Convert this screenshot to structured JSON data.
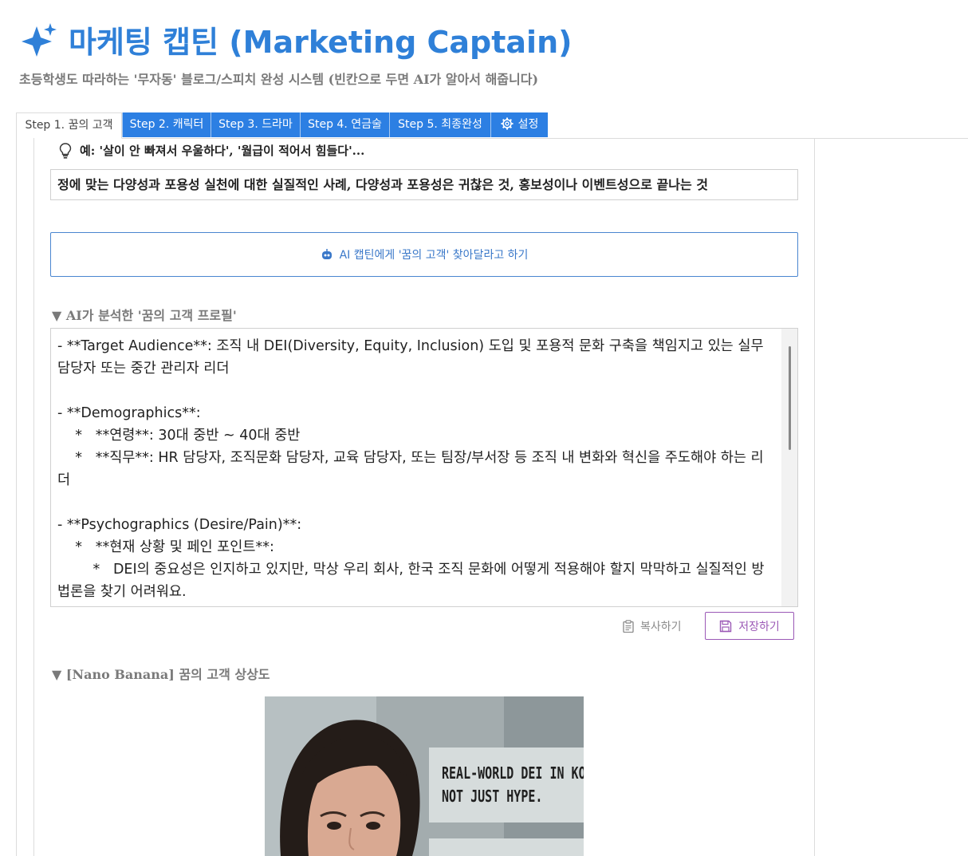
{
  "header": {
    "title": "마케팅 캡틴 (Marketing Captain)",
    "subtitle": "초등학생도 따라하는 '무자동' 블로그/스피치 완성 시스템 (빈칸으로 두면 AI가 알아서 해줍니다)"
  },
  "tabs": [
    {
      "label": "Step 1. 꿈의 고객",
      "active": true
    },
    {
      "label": "Step 2. 캐릭터",
      "active": false
    },
    {
      "label": "Step 3. 드라마",
      "active": false
    },
    {
      "label": "Step 4. 연금술",
      "active": false
    },
    {
      "label": "Step 5. 최종완성",
      "active": false
    },
    {
      "label": "설정",
      "active": false,
      "icon": "gear-icon"
    }
  ],
  "step1": {
    "hint": "예: '살이 안 빠져서 우울하다', '월급이 적어서 힘들다'...",
    "input_value": "정에 맞는 다양성과 포용성 실천에 대한 실질적인 사례, 다양성과 포용성은 귀찮은 것, 홍보성이나 이벤트성으로 끝나는 것",
    "ai_button_label": "AI 캡틴에게 '꿈의 고객' 찾아달라고 하기",
    "profile_section_title": "▼ AI가 분석한 '꿈의 고객 프로필'",
    "profile_text": "- **Target Audience**: 조직 내 DEI(Diversity, Equity, Inclusion) 도입 및 포용적 문화 구축을 책임지고 있는 실무 담당자 또는 중간 관리자 리더\n\n- **Demographics**:\n    *   **연령**: 30대 중반 ~ 40대 중반\n    *   **직무**: HR 담당자, 조직문화 담당자, 교육 담당자, 또는 팀장/부서장 등 조직 내 변화와 혁신을 주도해야 하는 리더\n\n- **Psychographics (Desire/Pain)**:\n    *   **현재 상황 및 페인 포인트**:\n        *   DEI의 중요성은 인지하고 있지만, 막상 우리 회사, 한국 조직 문화에 어떻게 적용해야 할지 막막하고 실질적인 방법론을 찾기 어려워요.",
    "copy_label": "복사하기",
    "save_label": "저장하기",
    "image_section_title": "▼ [Nano Banana] 꿈의 고객 상상도",
    "image_overlay_line1": "REAL-WORLD DEI IN KORE",
    "image_overlay_line2": "NOT JUST HYPE."
  },
  "colors": {
    "accent": "#2f80d8",
    "tab_blue": "#2c7fe3",
    "save_purple": "#9b59b6"
  }
}
